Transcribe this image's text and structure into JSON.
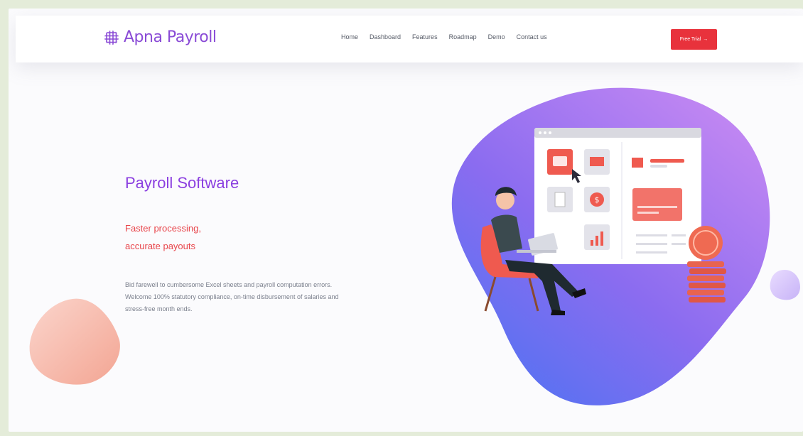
{
  "brand": {
    "name": "Apna Payroll",
    "color": "#8a4bd6"
  },
  "nav": {
    "items": [
      "Home",
      "Dashboard",
      "Features",
      "Roadmap",
      "Demo",
      "Contact us"
    ],
    "cta_label": "Free Trial",
    "cta_icon": "arrow-right-icon",
    "cta_color": "#e8323c"
  },
  "hero": {
    "title": "Payroll Software",
    "tagline_line1": "Faster processing,",
    "tagline_line2": "accurate payouts",
    "description_line1": "Bid farewell to cumbersome Excel sheets and payroll computation errors.",
    "description_line2": "Welcome 100% statutory compliance, on-time disbursement of salaries and",
    "description_line3": "stress-free month ends.",
    "title_color": "#8b3fe0",
    "tagline_color": "#e8454b"
  },
  "illustration": {
    "currency_symbol": "$"
  }
}
